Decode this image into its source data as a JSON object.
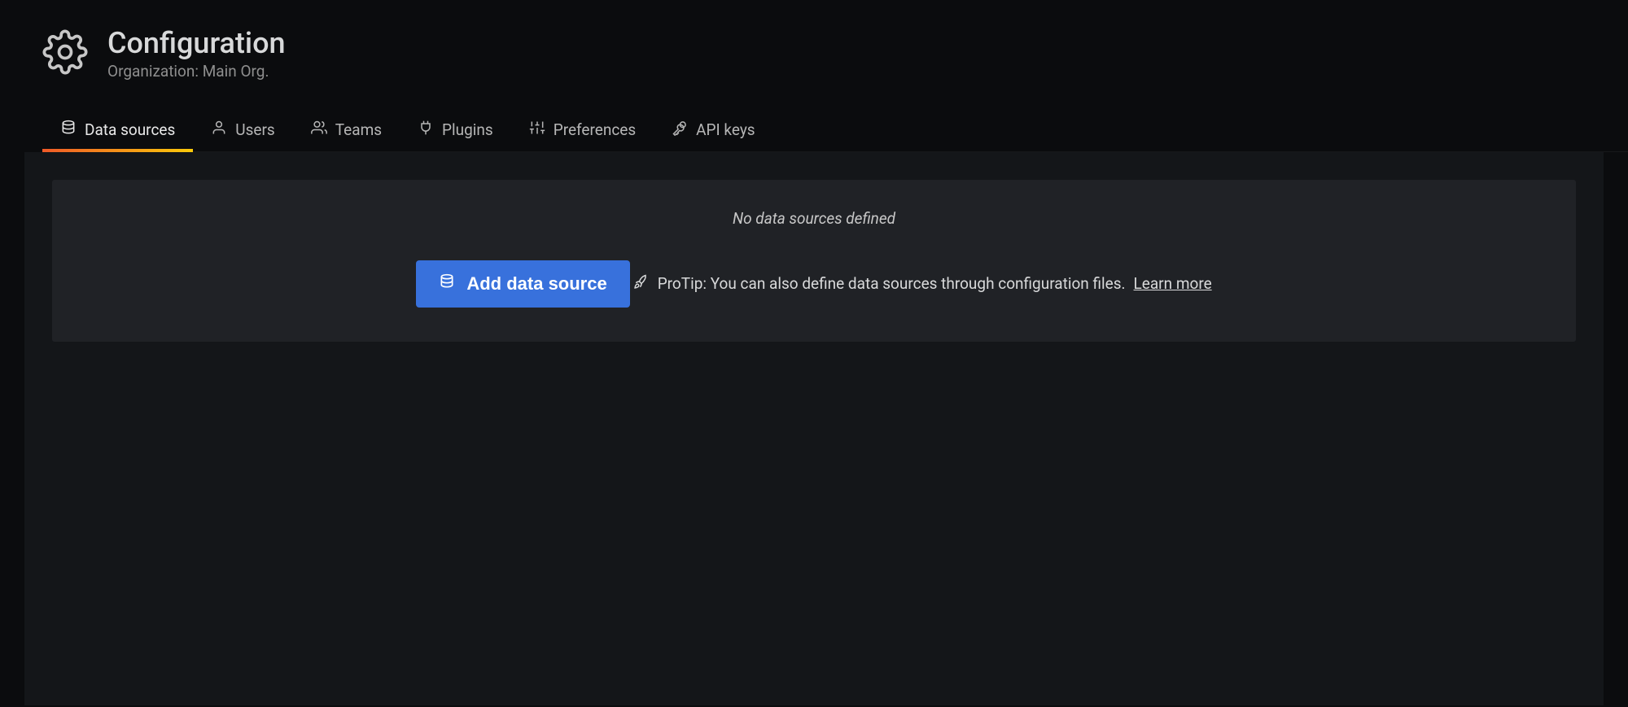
{
  "header": {
    "title": "Configuration",
    "subtitle": "Organization: Main Org."
  },
  "tabs": [
    {
      "label": "Data sources",
      "icon": "database-icon",
      "active": true
    },
    {
      "label": "Users",
      "icon": "user-icon",
      "active": false
    },
    {
      "label": "Teams",
      "icon": "users-icon",
      "active": false
    },
    {
      "label": "Plugins",
      "icon": "plug-icon",
      "active": false
    },
    {
      "label": "Preferences",
      "icon": "sliders-icon",
      "active": false
    },
    {
      "label": "API keys",
      "icon": "key-icon",
      "active": false
    }
  ],
  "main": {
    "empty_message": "No data sources defined",
    "add_button_label": "Add data source",
    "protip_text": "ProTip: You can also define data sources through configuration files. ",
    "protip_link_label": "Learn more"
  }
}
